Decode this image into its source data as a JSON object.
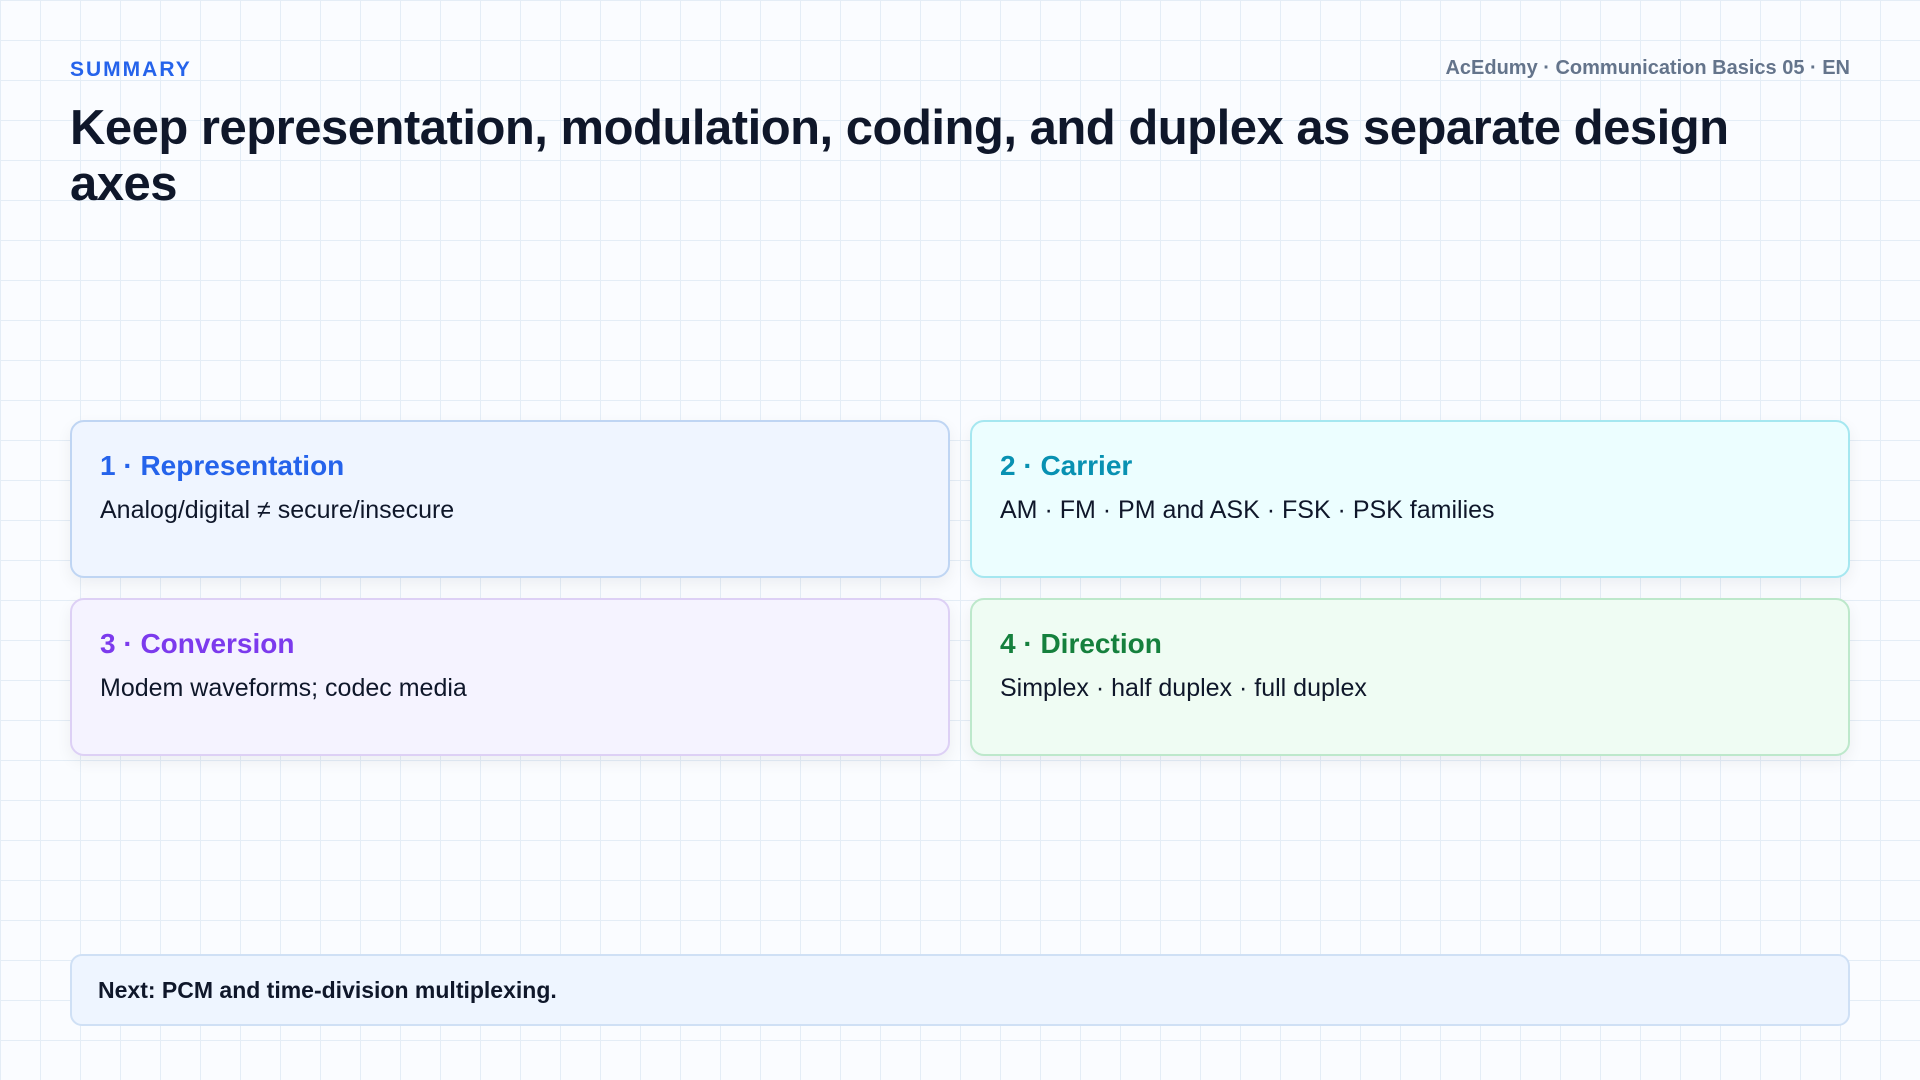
{
  "header": {
    "section_label": "SUMMARY",
    "course_label": "AcEdumy · Communication Basics 05 · EN",
    "title": "Keep representation, modulation, coding, and duplex as separate design axes"
  },
  "cards": [
    {
      "title": "1 · Representation",
      "body": "Analog/digital ≠ secure/insecure",
      "accent": "#2563eb",
      "background": "#eff5ff",
      "border": "#bfd5f3"
    },
    {
      "title": "2 · Carrier",
      "body": "AM · FM · PM and ASK · FSK · PSK families",
      "accent": "#0891b2",
      "background": "#ecfeff",
      "border": "#a5e7f0"
    },
    {
      "title": "3 · Conversion",
      "body": "Modem waveforms; codec media",
      "accent": "#7c3aed",
      "background": "#f5f3ff",
      "border": "#ddd0f5"
    },
    {
      "title": "4 · Direction",
      "body": "Simplex · half duplex · full duplex",
      "accent": "#15803d",
      "background": "#effcf3",
      "border": "#bde8cb"
    }
  ],
  "footer": {
    "note": "Next: PCM and time-division multiplexing."
  }
}
